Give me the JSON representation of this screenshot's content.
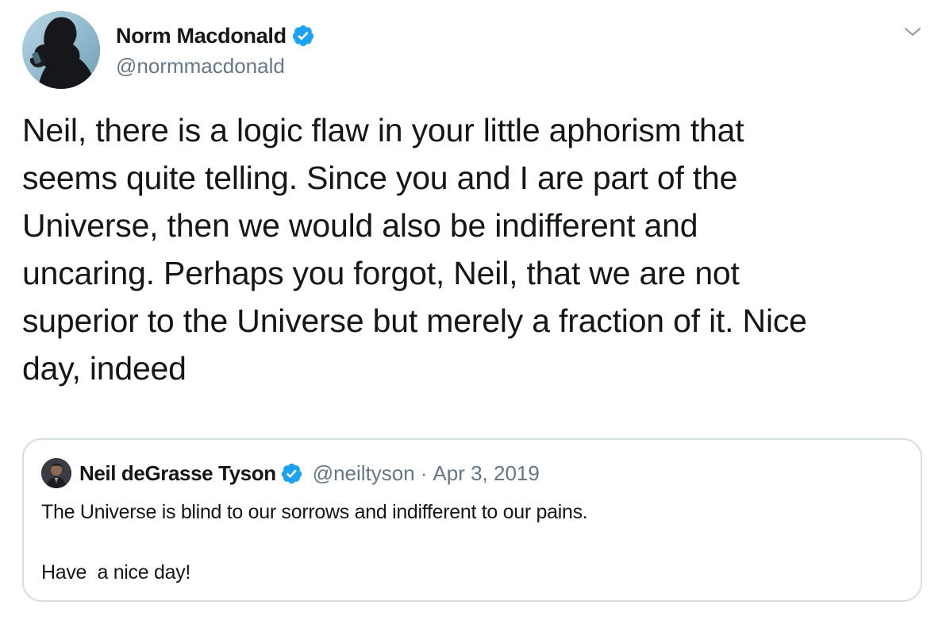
{
  "tweet": {
    "author": {
      "name": "Norm Macdonald",
      "handle": "@normmacdonald",
      "verified": true,
      "avatar_icon": "person-silhouette-avatar"
    },
    "menu_icon": "chevron-down-icon",
    "text": "Neil, there is a logic flaw in your little aphorism that\nseems quite telling. Since you and I are part of the\nUniverse, then we would also be indifferent and\nuncaring. Perhaps you forgot, Neil, that we are not\nsuperior to the Universe but merely a fraction of it. Nice\nday, indeed"
  },
  "quoted_tweet": {
    "author": {
      "name": "Neil deGrasse Tyson",
      "handle": "@neiltyson",
      "verified": true,
      "avatar_icon": "person-portrait-avatar"
    },
    "separator": "·",
    "date": "Apr 3, 2019",
    "text": "The Universe is blind to our sorrows and indifferent to our pains.\n\nHave  a nice day!"
  },
  "colors": {
    "text": "#14171a",
    "secondary": "#657786",
    "verified_blue": "#1da1f2",
    "border": "#d6dde3"
  }
}
